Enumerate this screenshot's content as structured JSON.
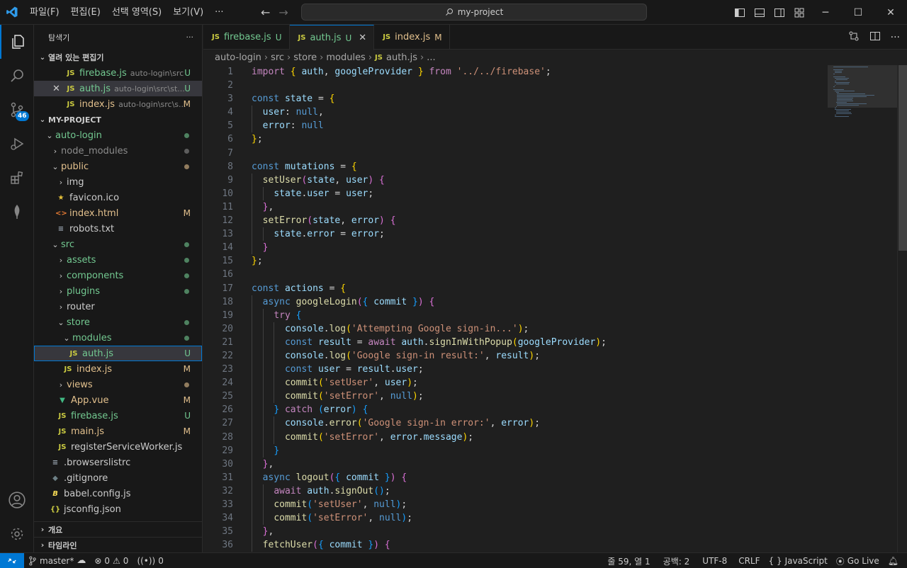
{
  "titlebar": {
    "menu": [
      "파일(F)",
      "편집(E)",
      "선택 영역(S)",
      "보기(V)",
      "···"
    ],
    "search_text": "my-project"
  },
  "activity": {
    "scm_badge": "46"
  },
  "sidebar": {
    "title": "탐색기",
    "more": "···",
    "open_editors_label": "열려 있는 편집기",
    "open_editors": [
      {
        "name": "firebase.js",
        "path": "auto-login\\src",
        "status": "U"
      },
      {
        "name": "auth.js",
        "path": "auto-login\\src\\st...",
        "status": "U"
      },
      {
        "name": "index.js",
        "path": "auto-login\\src\\s...",
        "status": "M"
      }
    ],
    "project_label": "MY-PROJECT",
    "tree": [
      {
        "name": "auto-login"
      },
      {
        "name": "node_modules"
      },
      {
        "name": "public"
      },
      {
        "name": "img"
      },
      {
        "name": "favicon.ico"
      },
      {
        "name": "index.html",
        "status": "M"
      },
      {
        "name": "robots.txt"
      },
      {
        "name": "src"
      },
      {
        "name": "assets"
      },
      {
        "name": "components"
      },
      {
        "name": "plugins"
      },
      {
        "name": "router"
      },
      {
        "name": "store"
      },
      {
        "name": "modules"
      },
      {
        "name": "auth.js",
        "status": "U"
      },
      {
        "name": "index.js",
        "status": "M"
      },
      {
        "name": "views"
      },
      {
        "name": "App.vue",
        "status": "M"
      },
      {
        "name": "firebase.js",
        "status": "U"
      },
      {
        "name": "main.js",
        "status": "M"
      },
      {
        "name": "registerServiceWorker.js"
      },
      {
        "name": ".browserslistrc"
      },
      {
        "name": ".gitignore"
      },
      {
        "name": "babel.config.js"
      },
      {
        "name": "jsconfig.json"
      }
    ],
    "outline_label": "개요",
    "timeline_label": "타임라인"
  },
  "tabs": [
    {
      "label": "firebase.js",
      "mark": "U"
    },
    {
      "label": "auth.js",
      "mark": "U"
    },
    {
      "label": "index.js",
      "mark": "M"
    }
  ],
  "breadcrumb": [
    "auto-login",
    "src",
    "store",
    "modules",
    "auth.js",
    "..."
  ],
  "code": {
    "line_numbers": [
      "1",
      "2",
      "3",
      "4",
      "5",
      "6",
      "7",
      "8",
      "9",
      "10",
      "11",
      "12",
      "13",
      "14",
      "15",
      "16",
      "17",
      "18",
      "19",
      "20",
      "21",
      "22",
      "23",
      "24",
      "25",
      "26",
      "27",
      "28",
      "29",
      "30",
      "31",
      "32",
      "33",
      "34",
      "35",
      "36"
    ],
    "lines": [
      "import { auth, googleProvider } from '../../firebase';",
      "",
      "const state = {",
      "  user: null,",
      "  error: null",
      "};",
      "",
      "const mutations = {",
      "  setUser(state, user) {",
      "    state.user = user;",
      "  },",
      "  setError(state, error) {",
      "    state.error = error;",
      "  }",
      "};",
      "",
      "const actions = {",
      "  async googleLogin({ commit }) {",
      "    try {",
      "      console.log('Attempting Google sign-in...');",
      "      const result = await auth.signInWithPopup(googleProvider);",
      "      console.log('Google sign-in result:', result);",
      "      const user = result.user;",
      "      commit('setUser', user);",
      "      commit('setError', null);",
      "    } catch (error) {",
      "      console.error('Google sign-in error:', error);",
      "      commit('setError', error.message);",
      "    }",
      "  },",
      "  async logout({ commit }) {",
      "    await auth.signOut();",
      "    commit('setUser', null);",
      "    commit('setError', null);",
      "  },",
      "  fetchUser({ commit }) {"
    ]
  },
  "statusbar": {
    "branch": "master*",
    "errors": "0",
    "warnings": "0",
    "ports": "0",
    "position": "줄 59, 열 1",
    "spaces": "공백: 2",
    "encoding": "UTF-8",
    "eol": "CRLF",
    "language": "JavaScript",
    "golive": "Go Live"
  }
}
